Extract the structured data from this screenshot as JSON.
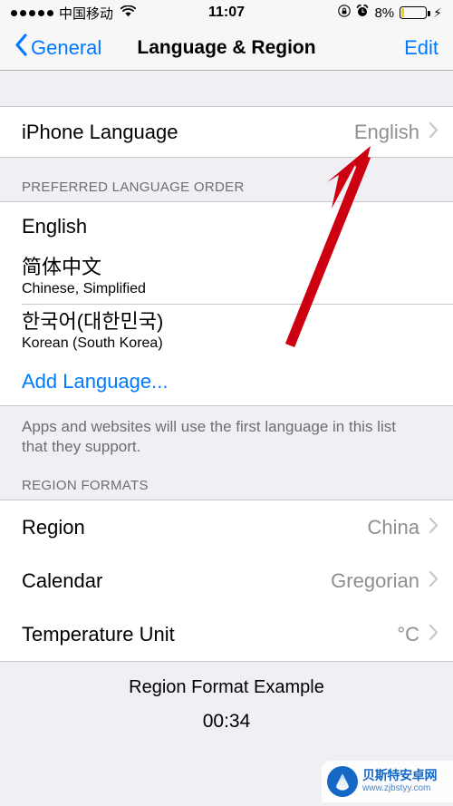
{
  "status_bar": {
    "signal_dots": 5,
    "carrier": "中国移动",
    "wifi_icon": "wifi-icon",
    "time": "11:07",
    "rotation_lock_icon": "rotation-lock-icon",
    "alarm_icon": "alarm-clock-icon",
    "battery_percent": "8%",
    "battery_level": 8,
    "battery_color": "#FFCC00",
    "charging_icon": "lightning-bolt-icon"
  },
  "nav_bar": {
    "back_label": "General",
    "back_icon": "chevron-left-icon",
    "title": "Language & Region",
    "edit_label": "Edit",
    "accent_color": "#007AFF"
  },
  "iphone_language": {
    "label": "iPhone Language",
    "value": "English",
    "chevron_icon": "chevron-right-icon"
  },
  "preferred_language_order": {
    "header": "PREFERRED LANGUAGE ORDER",
    "items": [
      {
        "native": "English",
        "english": ""
      },
      {
        "native": "简体中文",
        "english": "Chinese, Simplified"
      },
      {
        "native": "한국어(대한민국)",
        "english": "Korean (South Korea)"
      }
    ],
    "add_language_label": "Add Language...",
    "footer": "Apps and websites will use the first language in this list that they support."
  },
  "region_formats": {
    "header": "REGION FORMATS",
    "rows": [
      {
        "label": "Region",
        "value": "China"
      },
      {
        "label": "Calendar",
        "value": "Gregorian"
      },
      {
        "label": "Temperature Unit",
        "value": "°C"
      }
    ]
  },
  "region_example": {
    "title": "Region Format Example",
    "value": "00:34"
  },
  "annotation": {
    "arrow_color": "#CC0011",
    "arrow_name": "red-pointer-arrow"
  },
  "watermark": {
    "site_name": "贝斯特安卓网",
    "url": "www.zjbstyy.com",
    "logo_color": "#1668C6"
  }
}
